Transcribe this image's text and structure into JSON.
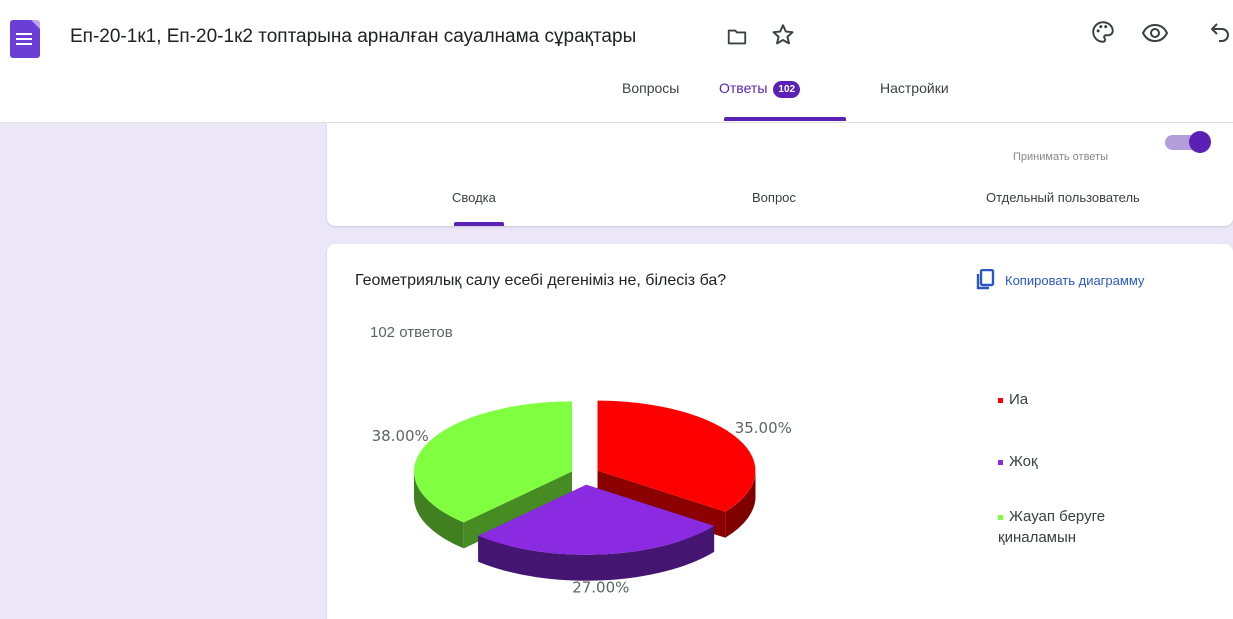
{
  "header": {
    "doc_title": "Еп-20-1к1, Еп-20-1к2 топтарына арналған сауалнама сұрақтары",
    "icons": [
      "forms-app-icon",
      "folder-icon",
      "star-icon",
      "palette-icon",
      "eye-icon",
      "undo-icon"
    ]
  },
  "tabs": {
    "questions": "Вопросы",
    "answers": "Ответы",
    "answers_count": "102",
    "settings": "Настройки"
  },
  "responses": {
    "accept_label": "Принимать ответы",
    "accept_on": true,
    "subtabs": [
      "Сводка",
      "Вопрос",
      "Отдельный пользователь"
    ]
  },
  "question": {
    "title": "Геометриялық салу есебі дегеніміз не, білесіз ба?",
    "copy_label": "Копировать диаграмму",
    "count_label": "102 ответов"
  },
  "chart_data": {
    "type": "pie",
    "categories": [
      "Иа",
      "Жоқ",
      "Жауап беруге қиналамын"
    ],
    "values": [
      35.0,
      27.0,
      38.0
    ],
    "data_labels": [
      "35.00%",
      "27.00%",
      "38.00%"
    ],
    "colors": [
      "#ff0000",
      "#8a2be2",
      "#80ff40"
    ],
    "legend_position": "right"
  },
  "colors": {
    "accent": "#5b21b6",
    "link": "#2a56c6",
    "page_bg": "#ece7f8"
  }
}
